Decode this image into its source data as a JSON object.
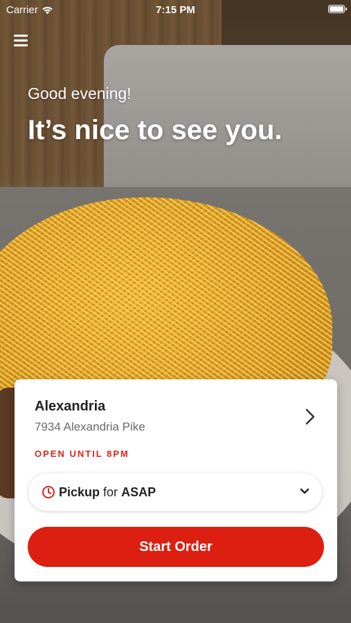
{
  "status_bar": {
    "carrier": "Carrier",
    "time": "7:15 PM"
  },
  "header": {
    "greeting": "Good evening!",
    "headline": "It’s nice to see you."
  },
  "store": {
    "name": "Alexandria",
    "address": "7934 Alexandria Pike",
    "hours_status": "OPEN UNTIL 8PM"
  },
  "pickup": {
    "mode": "Pickup",
    "connector": "for",
    "time": "ASAP"
  },
  "actions": {
    "start_order": "Start Order"
  },
  "colors": {
    "brand_red": "#dc1f10",
    "status_red": "#d8261b"
  },
  "icons": [
    "wifi-icon",
    "battery-icon",
    "menu-icon",
    "chevron-right-icon",
    "clock-icon",
    "chevron-down-icon"
  ]
}
